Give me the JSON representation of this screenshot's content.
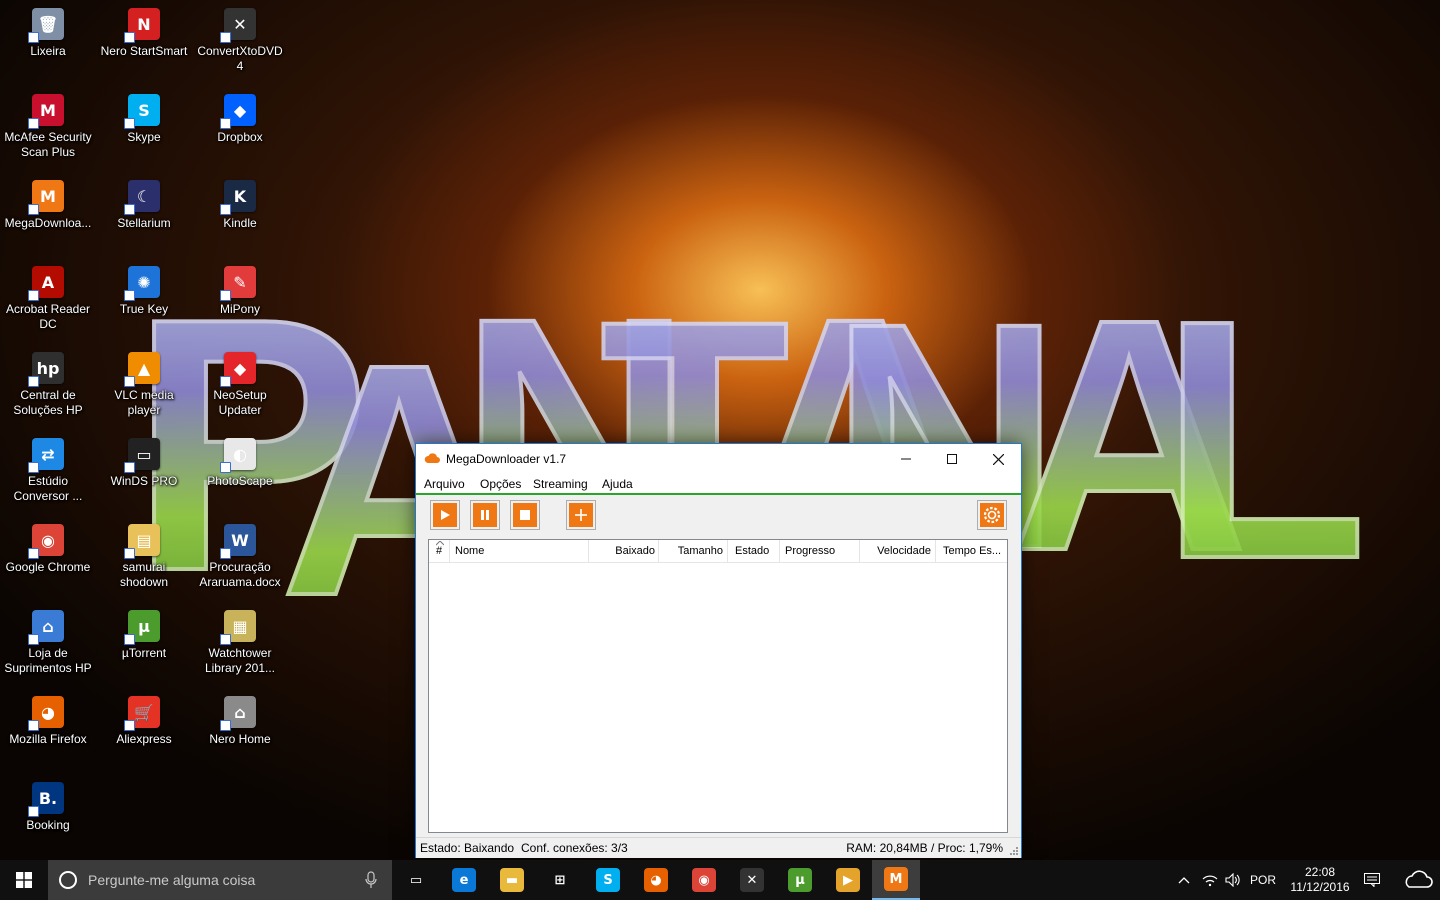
{
  "desktop": {
    "wallpaper_text": "PANTANAL",
    "icons": [
      {
        "label": "Lixeira",
        "icon": "recycle-bin-icon",
        "color": "#7f8fa6",
        "glyph": "🗑"
      },
      {
        "label": "Nero StartSmart",
        "icon": "nero-icon",
        "color": "#d42020",
        "glyph": "N"
      },
      {
        "label": "ConvertXtoDVD 4",
        "icon": "convertx-icon",
        "color": "#333333",
        "glyph": "✕"
      },
      {
        "label": "McAfee Security\nScan Plus",
        "icon": "mcafee-icon",
        "color": "#c8102e",
        "glyph": "M"
      },
      {
        "label": "Skype",
        "icon": "skype-icon",
        "color": "#00aff0",
        "glyph": "S"
      },
      {
        "label": "Dropbox",
        "icon": "dropbox-icon",
        "color": "#0061fe",
        "glyph": "◆"
      },
      {
        "label": "MegaDownloa...",
        "icon": "megadownloader-icon",
        "color": "#f07814",
        "glyph": "M"
      },
      {
        "label": "Stellarium",
        "icon": "stellarium-icon",
        "color": "#2b2f6b",
        "glyph": "☾"
      },
      {
        "label": "Kindle",
        "icon": "kindle-icon",
        "color": "#1a2a44",
        "glyph": "K"
      },
      {
        "label": "Acrobat Reader\nDC",
        "icon": "acrobat-icon",
        "color": "#b30b00",
        "glyph": "A"
      },
      {
        "label": "True Key",
        "icon": "truekey-icon",
        "color": "#1e73d8",
        "glyph": "✺"
      },
      {
        "label": "MiPony",
        "icon": "mipony-icon",
        "color": "#e23b3b",
        "glyph": "✎"
      },
      {
        "label": "Central de\nSoluções HP",
        "icon": "hp-icon",
        "color": "#2f2f2f",
        "glyph": "hp"
      },
      {
        "label": "VLC media player",
        "icon": "vlc-icon",
        "color": "#f08c00",
        "glyph": "▲"
      },
      {
        "label": "NeoSetup\nUpdater",
        "icon": "neosetup-icon",
        "color": "#e4262b",
        "glyph": "◆"
      },
      {
        "label": "Estúdio\nConversor ...",
        "icon": "converter-icon",
        "color": "#1e88e5",
        "glyph": "⇄"
      },
      {
        "label": "WinDS PRO",
        "icon": "winds-icon",
        "color": "#222222",
        "glyph": "▭"
      },
      {
        "label": "PhotoScape",
        "icon": "photoscape-icon",
        "color": "#e8e8e8",
        "glyph": "◐"
      },
      {
        "label": "Google Chrome",
        "icon": "chrome-icon",
        "color": "#db4437",
        "glyph": "◉"
      },
      {
        "label": "samurai\nshodown",
        "icon": "folder-icon",
        "color": "#e8c15a",
        "glyph": "▤"
      },
      {
        "label": "Procuração\nAraruama.docx",
        "icon": "word-doc-icon",
        "color": "#2b579a",
        "glyph": "W"
      },
      {
        "label": "Loja de\nSuprimentos HP",
        "icon": "hp-store-icon",
        "color": "#3a7bd5",
        "glyph": "⌂"
      },
      {
        "label": "µTorrent",
        "icon": "utorrent-icon",
        "color": "#4b9c2d",
        "glyph": "µ"
      },
      {
        "label": "Watchtower\nLibrary 201...",
        "icon": "watchtower-icon",
        "color": "#c9b35a",
        "glyph": "▦"
      },
      {
        "label": "Mozilla Firefox",
        "icon": "firefox-icon",
        "color": "#e66000",
        "glyph": "◕"
      },
      {
        "label": "Aliexpress",
        "icon": "aliexpress-icon",
        "color": "#e43225",
        "glyph": "🛒"
      },
      {
        "label": "Nero Home",
        "icon": "nero-home-icon",
        "color": "#8a8a8a",
        "glyph": "⌂"
      },
      {
        "label": "Booking",
        "icon": "booking-icon",
        "color": "#003580",
        "glyph": "B."
      }
    ]
  },
  "window": {
    "title": "MegaDownloader v1.7",
    "menu": [
      "Arquivo",
      "Opções",
      "Streaming",
      "Ajuda"
    ],
    "toolbar": {
      "start": "play-icon",
      "pause": "pause-icon",
      "stop": "stop-icon",
      "add": "plus-icon",
      "config": "gear-icon"
    },
    "columns": [
      "#",
      "Nome",
      "Baixado",
      "Tamanho",
      "Estado",
      "Progresso",
      "Velocidade",
      "Tempo Es..."
    ],
    "rows": [],
    "status": {
      "state": "Estado: Baixando",
      "connections": "Conf. conexões: 3/3",
      "resources": "RAM: 20,84MB / Proc: 1,79%"
    },
    "accent": "#f07814"
  },
  "taskbar": {
    "search_placeholder": "Pergunte-me alguma coisa",
    "apps": [
      {
        "icon": "task-view-icon",
        "color": "#101010",
        "glyph": "▭"
      },
      {
        "icon": "edge-icon",
        "color": "#0a78d7",
        "glyph": "e"
      },
      {
        "icon": "file-explorer-icon",
        "color": "#e8b93a",
        "glyph": "▬"
      },
      {
        "icon": "store-icon",
        "color": "#101010",
        "glyph": "⊞"
      },
      {
        "icon": "skype-icon",
        "color": "#00aff0",
        "glyph": "S"
      },
      {
        "icon": "firefox-icon",
        "color": "#e66000",
        "glyph": "◕"
      },
      {
        "icon": "chrome-icon",
        "color": "#db4437",
        "glyph": "◉"
      },
      {
        "icon": "convertx-icon",
        "color": "#333333",
        "glyph": "✕"
      },
      {
        "icon": "utorrent-icon",
        "color": "#4b9c2d",
        "glyph": "µ"
      },
      {
        "icon": "media-player-icon",
        "color": "#e4a32a",
        "glyph": "▶"
      },
      {
        "icon": "megadownloader-icon",
        "color": "#f07814",
        "glyph": "M"
      }
    ],
    "language": "POR",
    "time": "22:08",
    "date": "11/12/2016"
  }
}
